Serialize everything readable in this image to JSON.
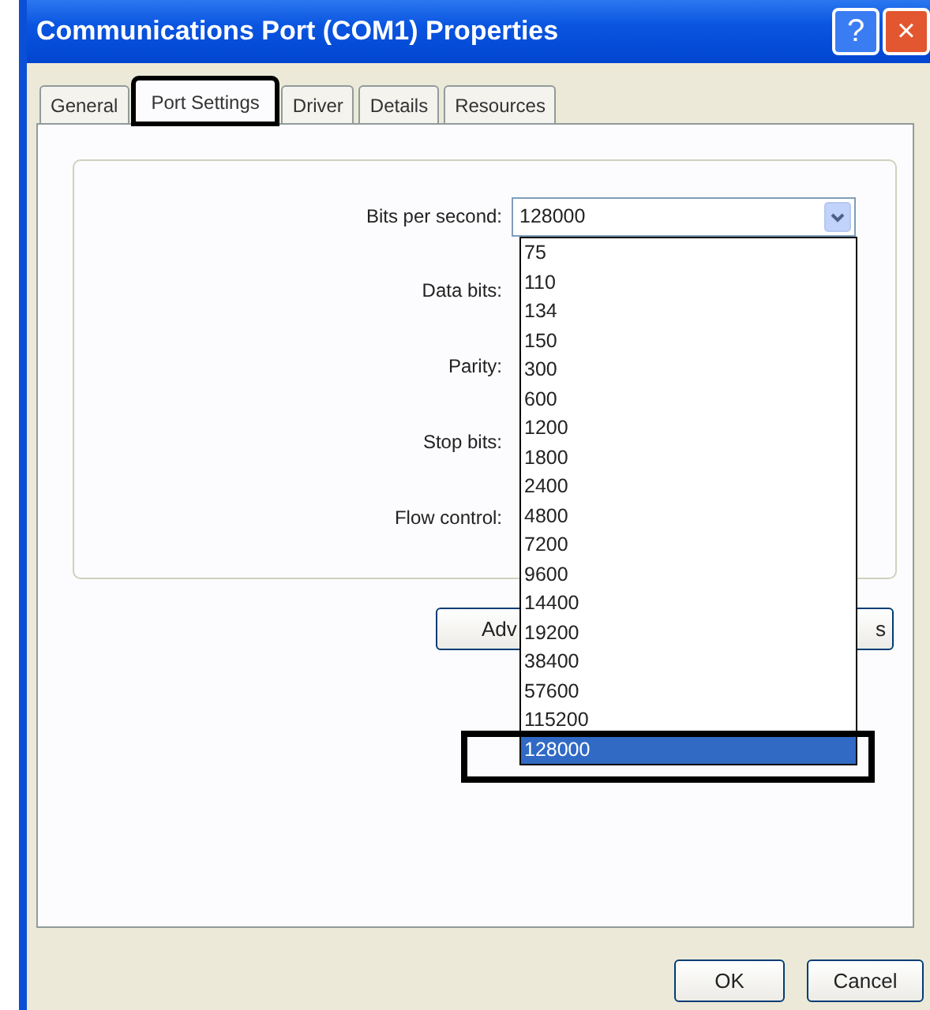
{
  "window": {
    "title": "Communications Port (COM1) Properties",
    "help_button": "?",
    "close_button": "×"
  },
  "tabs": [
    {
      "label": "General",
      "selected": false,
      "outlined": false
    },
    {
      "label": "Port Settings",
      "selected": true,
      "outlined": true
    },
    {
      "label": "Driver",
      "selected": false,
      "outlined": false
    },
    {
      "label": "Details",
      "selected": false,
      "outlined": false
    },
    {
      "label": "Resources",
      "selected": false,
      "outlined": false
    }
  ],
  "settings": {
    "labels": [
      "Bits per second:",
      "Data bits:",
      "Parity:",
      "Stop bits:",
      "Flow control:"
    ],
    "bits_per_second": {
      "value": "128000",
      "expanded": true,
      "options": [
        {
          "label": "75",
          "selected": false,
          "outlined": false
        },
        {
          "label": "110",
          "selected": false,
          "outlined": false
        },
        {
          "label": "134",
          "selected": false,
          "outlined": false
        },
        {
          "label": "150",
          "selected": false,
          "outlined": false
        },
        {
          "label": "300",
          "selected": false,
          "outlined": false
        },
        {
          "label": "600",
          "selected": false,
          "outlined": false
        },
        {
          "label": "1200",
          "selected": false,
          "outlined": false
        },
        {
          "label": "1800",
          "selected": false,
          "outlined": false
        },
        {
          "label": "2400",
          "selected": false,
          "outlined": false
        },
        {
          "label": "4800",
          "selected": false,
          "outlined": false
        },
        {
          "label": "7200",
          "selected": false,
          "outlined": false
        },
        {
          "label": "9600",
          "selected": false,
          "outlined": false
        },
        {
          "label": "14400",
          "selected": false,
          "outlined": false
        },
        {
          "label": "19200",
          "selected": false,
          "outlined": false
        },
        {
          "label": "38400",
          "selected": false,
          "outlined": false
        },
        {
          "label": "57600",
          "selected": false,
          "outlined": false
        },
        {
          "label": "115200",
          "selected": false,
          "outlined": false
        },
        {
          "label": "128000",
          "selected": true,
          "outlined": true
        }
      ]
    }
  },
  "buttons_partial": [
    "Adv",
    "s"
  ],
  "footer_buttons": [
    "OK",
    "Cancel"
  ]
}
